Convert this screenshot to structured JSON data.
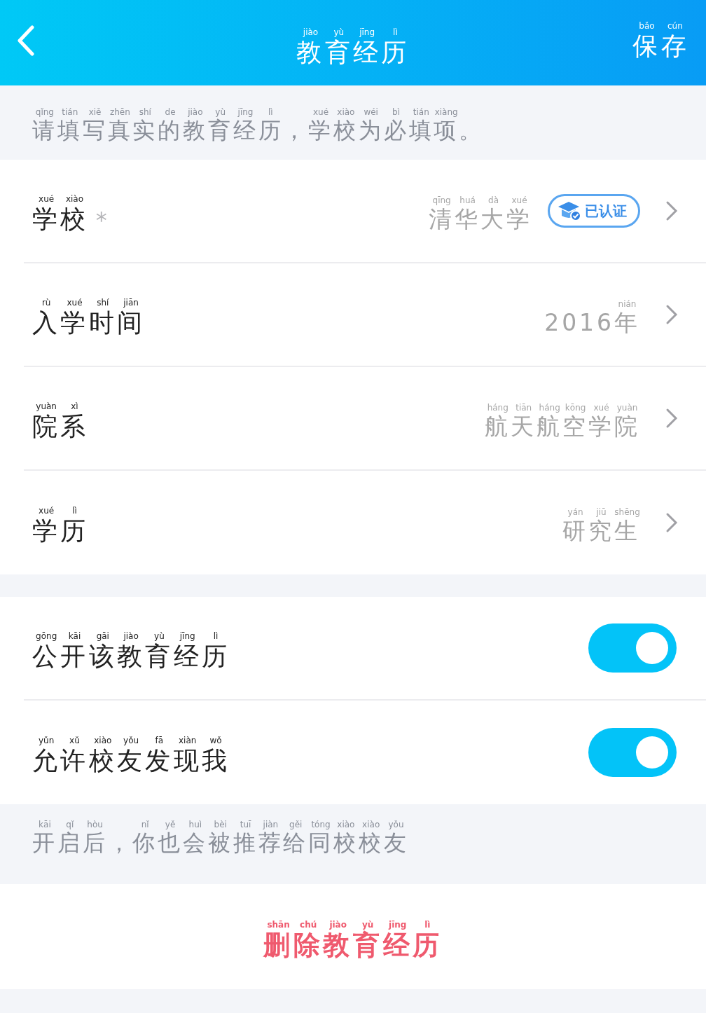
{
  "header": {
    "title": {
      "text": "教育经历",
      "pinyin": "jiào yù jīng lì"
    },
    "save": {
      "text": "保存",
      "pinyin": "bǎo cún"
    }
  },
  "hint": {
    "text": "请填写真实的教育经历，学校为必填项。",
    "pinyin": "qǐng tián xiě zhēn shí de jiào yù jīng lì xué xiào wéi bì tián xiàng"
  },
  "fields": [
    {
      "label": {
        "text": "学校",
        "pinyin": "xué xiào"
      },
      "required": true,
      "required_mark": "*",
      "value": {
        "text": "清华大学",
        "pinyin": "qīng huá dà xué"
      },
      "verified": true,
      "badge": "已认证"
    },
    {
      "label": {
        "text": "入学时间",
        "pinyin": "rù xué shí jiān"
      },
      "required": false,
      "value": {
        "text": "2016年",
        "pinyin": "nián"
      },
      "verified": false
    },
    {
      "label": {
        "text": "院系",
        "pinyin": "yuàn xì"
      },
      "required": false,
      "value": {
        "text": "航天航空学院",
        "pinyin": "háng tiān háng kōng xué yuàn"
      },
      "verified": false
    },
    {
      "label": {
        "text": "学历",
        "pinyin": "xué lì"
      },
      "required": false,
      "value": {
        "text": "研究生",
        "pinyin": "yán jiū shēng"
      },
      "verified": false
    }
  ],
  "toggles": [
    {
      "label": {
        "text": "公开该教育经历",
        "pinyin": "gōng kāi gāi jiào yù jīng lì"
      },
      "on": true
    },
    {
      "label": {
        "text": "允许校友发现我",
        "pinyin": "yǔn xǔ xiào yǒu fā xiàn wǒ"
      },
      "on": true
    }
  ],
  "note": {
    "text": "开启后，你也会被推荐给同校校友",
    "pinyin": "kāi qǐ hòu nǐ yě huì bèi tuī jiàn gěi tóng xiào xiào yǒu"
  },
  "delete": {
    "text": "删除教育经历",
    "pinyin": "shān chú jiào yù jīng lì"
  }
}
